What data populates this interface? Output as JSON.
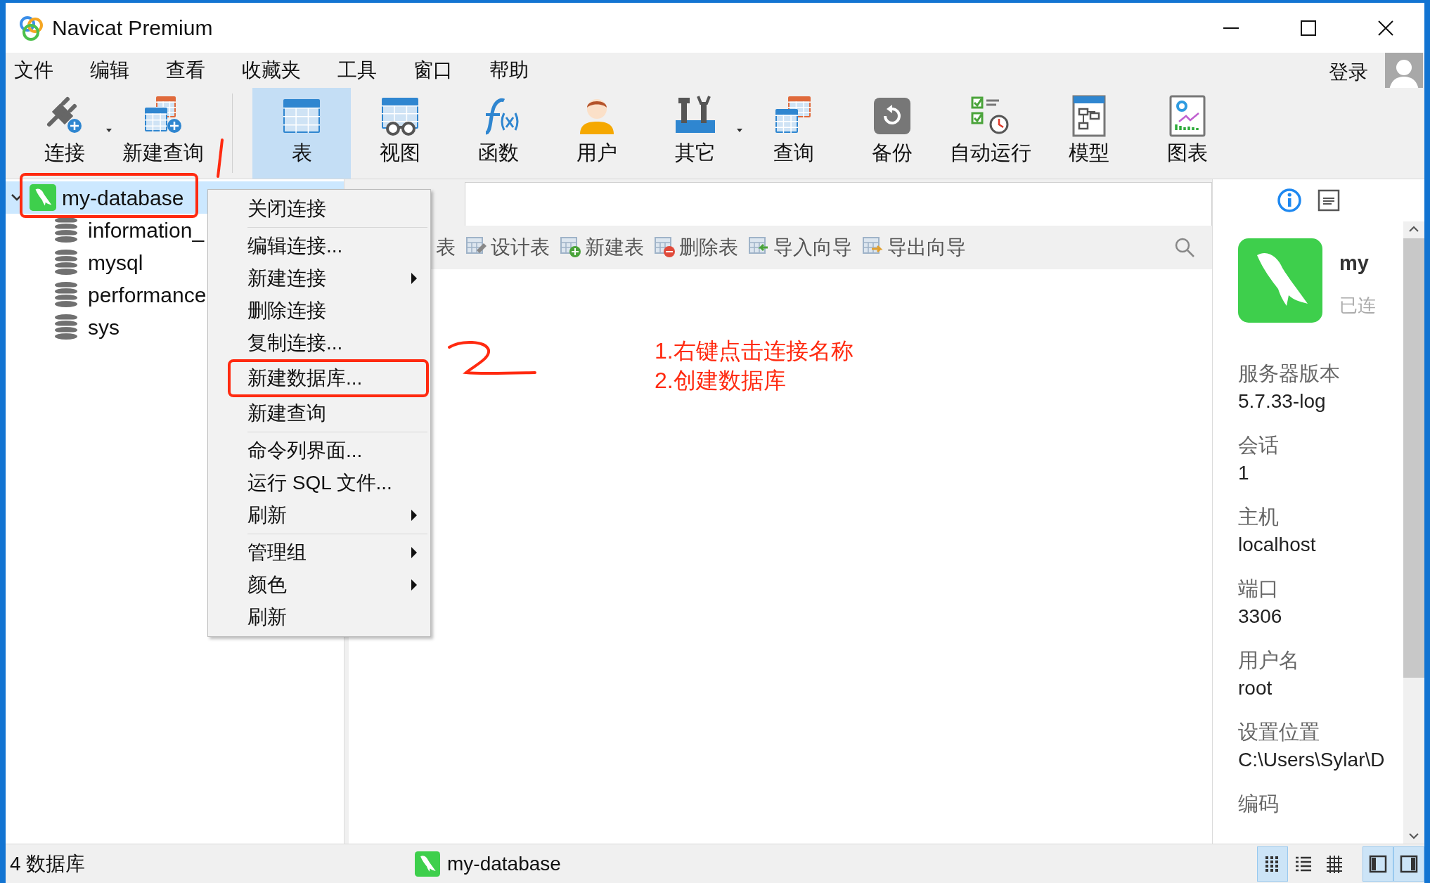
{
  "window": {
    "title": "Navicat Premium"
  },
  "menu_bar": [
    "文件",
    "编辑",
    "查看",
    "收藏夹",
    "工具",
    "窗口",
    "帮助"
  ],
  "login": "登录",
  "toolbar": {
    "groups": [
      {
        "items": [
          {
            "label": "连接",
            "selected": false,
            "dropdown": true
          },
          {
            "label": "新建查询",
            "selected": false,
            "dropdown": false
          }
        ]
      },
      {
        "items": [
          {
            "label": "表",
            "selected": true,
            "dropdown": false
          },
          {
            "label": "视图",
            "selected": false,
            "dropdown": false
          },
          {
            "label": "函数",
            "selected": false,
            "dropdown": false
          },
          {
            "label": "用户",
            "selected": false,
            "dropdown": false
          },
          {
            "label": "其它",
            "selected": false,
            "dropdown": true
          },
          {
            "label": "查询",
            "selected": false,
            "dropdown": false
          },
          {
            "label": "备份",
            "selected": false,
            "dropdown": false
          },
          {
            "label": "自动运行",
            "selected": false,
            "dropdown": false
          },
          {
            "label": "模型",
            "selected": false,
            "dropdown": false
          },
          {
            "label": "图表",
            "selected": false,
            "dropdown": false
          }
        ]
      }
    ]
  },
  "tree": {
    "items": [
      {
        "label": "my-database",
        "selected": true,
        "expanded": true,
        "annotated": true,
        "children": [
          {
            "label": "information_"
          },
          {
            "label": "mysql"
          },
          {
            "label": "performance"
          },
          {
            "label": "sys"
          }
        ]
      }
    ]
  },
  "context_menu": {
    "items": [
      {
        "kind": "item",
        "label": "关闭连接",
        "submenu": false,
        "annotated": false
      },
      {
        "kind": "separator"
      },
      {
        "kind": "item",
        "label": "编辑连接...",
        "submenu": false,
        "annotated": false
      },
      {
        "kind": "item",
        "label": "新建连接",
        "submenu": true,
        "annotated": false
      },
      {
        "kind": "item",
        "label": "删除连接",
        "submenu": false,
        "annotated": false
      },
      {
        "kind": "item",
        "label": "复制连接...",
        "submenu": false,
        "annotated": false
      },
      {
        "kind": "item",
        "label": "新建数据库...",
        "submenu": false,
        "annotated": true
      },
      {
        "kind": "item",
        "label": "新建查询",
        "submenu": false,
        "annotated": false
      },
      {
        "kind": "separator"
      },
      {
        "kind": "item",
        "label": "命令列界面...",
        "submenu": false,
        "annotated": false
      },
      {
        "kind": "item",
        "label": "运行 SQL 文件...",
        "submenu": false,
        "annotated": false
      },
      {
        "kind": "item",
        "label": "刷新",
        "submenu": true,
        "annotated": false
      },
      {
        "kind": "separator"
      },
      {
        "kind": "item",
        "label": "管理组",
        "submenu": true,
        "annotated": false
      },
      {
        "kind": "item",
        "label": "颜色",
        "submenu": true,
        "annotated": false
      },
      {
        "kind": "item",
        "label": "刷新",
        "submenu": false,
        "annotated": false
      }
    ]
  },
  "object_toolbar": {
    "items": [
      {
        "kind": "label",
        "label": "表"
      },
      {
        "kind": "tool",
        "label": "设计表"
      },
      {
        "kind": "tool",
        "label": "新建表"
      },
      {
        "kind": "tool",
        "label": "删除表"
      },
      {
        "kind": "tool",
        "label": "导入向导"
      },
      {
        "kind": "tool",
        "label": "导出向导"
      }
    ]
  },
  "annotation": {
    "lines": [
      "1.右键点击连接名称",
      "2.创建数据库"
    ]
  },
  "info_panel": {
    "name": "my",
    "status": "已连",
    "fields": [
      {
        "label": "服务器版本",
        "value": "5.7.33-log"
      },
      {
        "label": "会话",
        "value": "1"
      },
      {
        "label": "主机",
        "value": "localhost"
      },
      {
        "label": "端口",
        "value": "3306"
      },
      {
        "label": "用户名",
        "value": "root"
      },
      {
        "label": "设置位置",
        "value": "C:\\Users\\Sylar\\D"
      },
      {
        "label": "编码"
      }
    ]
  },
  "status_bar": {
    "count": "4 数据库",
    "connection": "my-database",
    "view_buttons": [
      {
        "selected": true
      },
      {
        "selected": false
      },
      {
        "selected": false
      }
    ],
    "panel_buttons": [
      {
        "selected": true
      },
      {
        "selected": true
      }
    ]
  }
}
